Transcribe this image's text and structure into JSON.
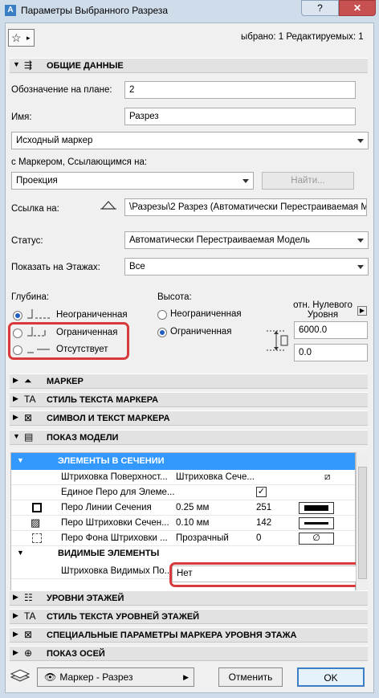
{
  "window": {
    "app_icon": "A",
    "title": "Параметры Выбранного Разреза",
    "help_label": "?",
    "close_label": "✕"
  },
  "toolbar": {
    "favorites_icon": "star-icon",
    "selected_info": "ыбрано: 1 Редактируемых: 1"
  },
  "sections": {
    "general": "ОБЩИЕ ДАННЫЕ",
    "marker": "МАРКЕР",
    "marker_text_style": "СТИЛЬ ТЕКСТА МАРКЕРА",
    "marker_symbol_text": "СИМВОЛ И ТЕКСТ МАРКЕРА",
    "model_display": "ПОКАЗ МОДЕЛИ",
    "story_levels": "УРОВНИ ЭТАЖЕЙ",
    "story_levels_text_style": "СТИЛЬ ТЕКСТА УРОВНЕЙ ЭТАЖЕЙ",
    "story_level_marker_params": "СПЕЦИАЛЬНЫЕ ПАРАМЕТРЫ МАРКЕРА УРОВНЯ ЭТАЖА",
    "grid_display": "ПОКАЗ ОСЕЙ"
  },
  "general": {
    "plan_id_label": "Обозначение на плане:",
    "plan_id_value": "2",
    "name_label": "Имя:",
    "name_value": "Разрез",
    "marker_type_value": "Исходный маркер",
    "ref_marker_label": "с Маркером, Ссылающимся на:",
    "ref_marker_value": "Проекция",
    "find_button": "Найти...",
    "link_label": "Ссылка на:",
    "link_value": "\\Разрезы\\2 Разрез (Автоматически Перестраиваемая М",
    "status_label": "Статус:",
    "status_value": "Автоматически Перестраиваемая Модель",
    "show_on_stories_label": "Показать на Этажах:",
    "show_on_stories_value": "Все"
  },
  "depth": {
    "label": "Глубина:",
    "options": [
      "Неограниченная",
      "Ограниченная",
      "Отсутствует"
    ],
    "selected": 0
  },
  "height": {
    "label": "Высота:",
    "options": [
      "Неограниченная",
      "Ограниченная"
    ],
    "selected": 1,
    "reference_label": "отн. Нулевого Уровня",
    "top_value": "6000.0",
    "bottom_value": "0.0"
  },
  "model_display": {
    "cut_elements_header": "ЭЛЕМЕНТЫ В СЕЧЕНИИ",
    "rows": [
      {
        "label": "Штриховка Поверхност...",
        "value": "Штриховка Сече...",
        "extra": ""
      },
      {
        "label": "Единое Перо для Элеме...",
        "value": "",
        "extra": "✓"
      },
      {
        "label": "Перо Линии Сечения",
        "value": "0.25 мм",
        "extra": "251"
      },
      {
        "label": "Перо Штриховки Сечен...",
        "value": "0.10 мм",
        "extra": "142"
      },
      {
        "label": "Перо Фона Штриховки ...",
        "value": "Прозрачный",
        "extra": "0"
      }
    ],
    "visible_elements_header": "ВИДИМЫЕ ЭЛЕМЕНТЫ",
    "visible_fill_label": "Штриховка Видимых По...",
    "visible_fill_value": "Нет",
    "empty_pen_symbol": "∅"
  },
  "footer": {
    "layer_value": "Маркер - Разрез",
    "cancel_button": "Отменить",
    "ok_button": "OK"
  },
  "colors": {
    "selection": "#3399ff",
    "highlight_box": "#d8393a"
  }
}
